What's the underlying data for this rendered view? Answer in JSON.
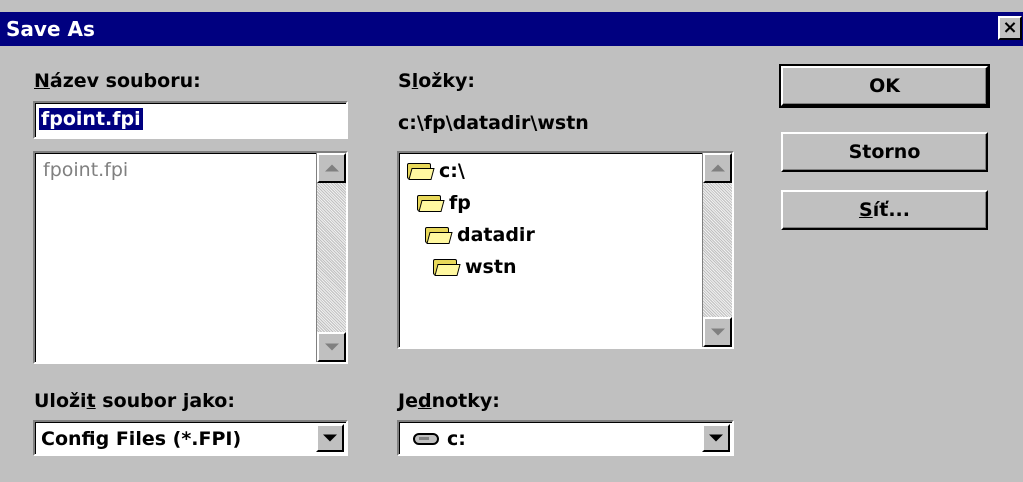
{
  "window": {
    "title": "Save As",
    "close_glyph": "×"
  },
  "filename": {
    "label_mnemonic": "N",
    "label_rest": "ázev souboru:",
    "value": "fpoint.fpi",
    "list_items": [
      "fpoint.fpi"
    ]
  },
  "folders": {
    "label_start": "S",
    "label_mnemonic": "l",
    "label_rest": "ožky:",
    "current_path": "c:\\fp\\datadir\\wstn",
    "items": [
      "c:\\",
      "fp",
      "datadir",
      "wstn"
    ]
  },
  "save_type": {
    "label_start": "Uloži",
    "label_mnemonic": "t",
    "label_rest": " soubor jako:",
    "selected": "Config Files (*.FPI)"
  },
  "drives": {
    "label_start": "Je",
    "label_mnemonic": "d",
    "label_rest": "notky:",
    "selected": "c:"
  },
  "buttons": {
    "ok": "OK",
    "storno": "Storno",
    "sit_mnemonic": "S",
    "sit_rest": "íť..."
  },
  "icons": {
    "folder": "folder-open-icon",
    "drive": "hard-drive-icon",
    "scroll_up": "arrow-up-icon",
    "scroll_down": "arrow-down-icon",
    "dropdown": "chevron-down-icon"
  },
  "colors": {
    "titlebar": "#000080",
    "face": "#c0c0c0",
    "selection": "#000080"
  }
}
